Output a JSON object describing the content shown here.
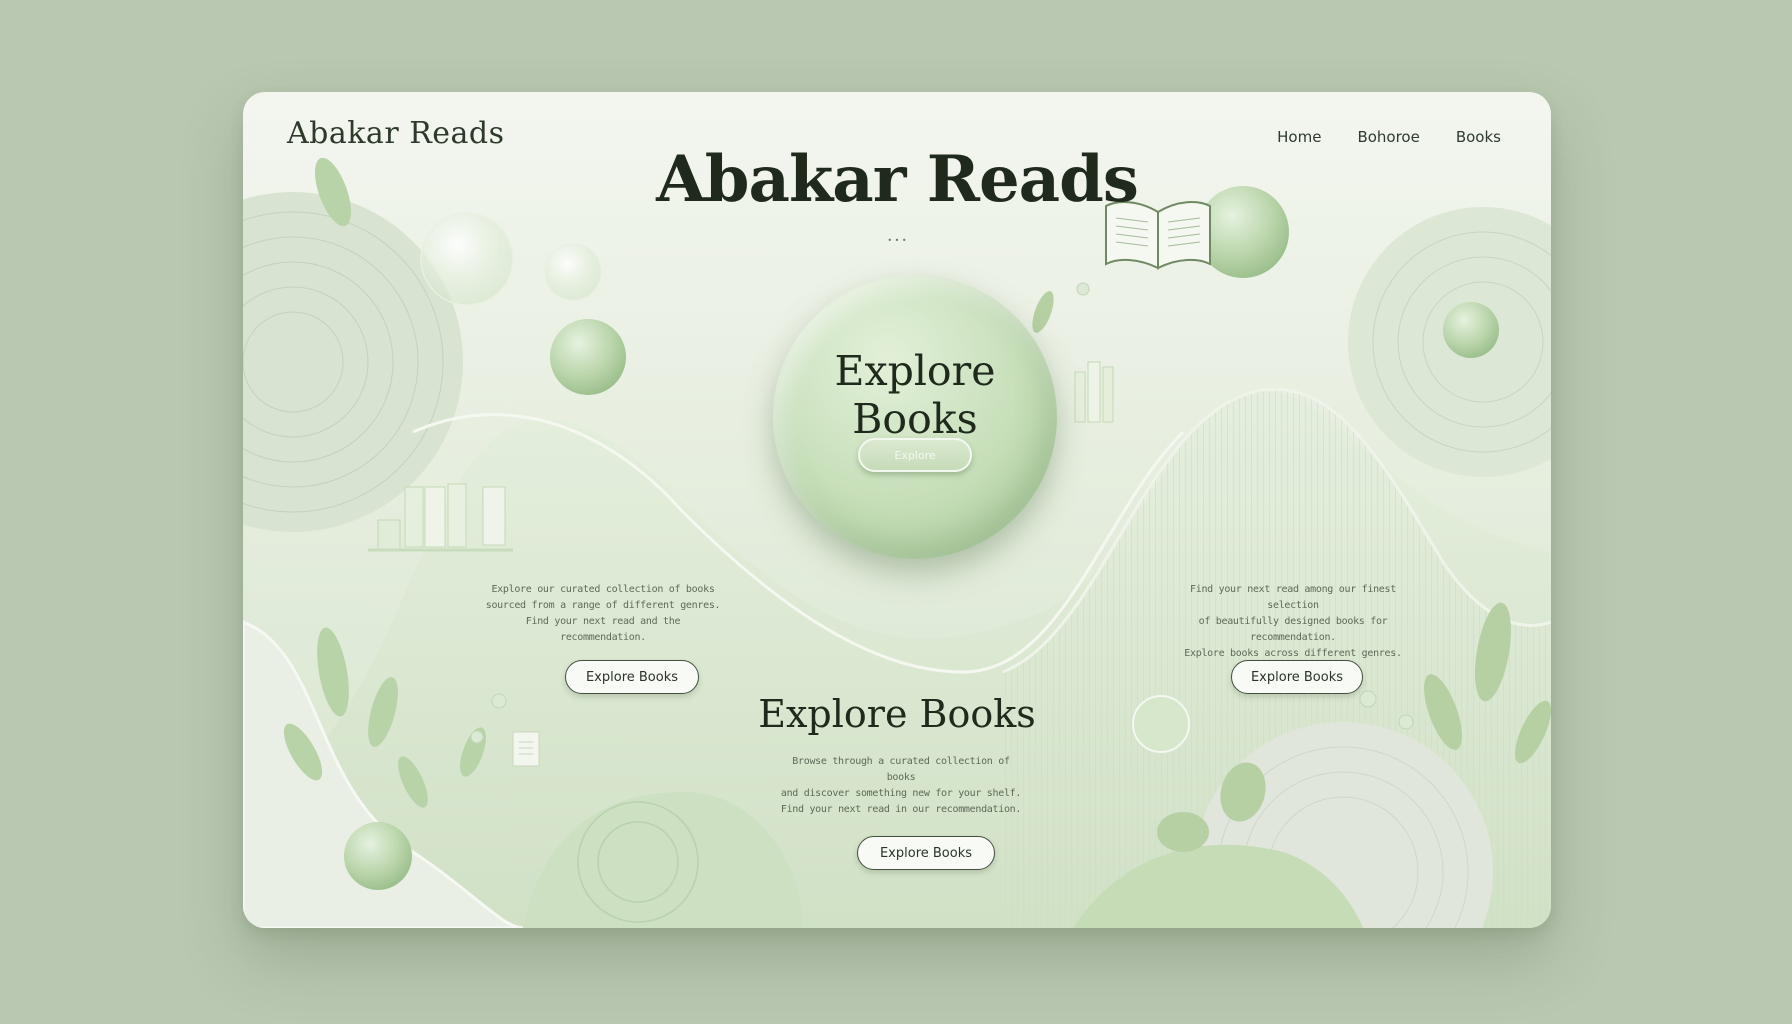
{
  "header": {
    "brand": "Abakar Reads",
    "nav": [
      "Home",
      "Bohoroe",
      "Books"
    ]
  },
  "hero": {
    "title": "Abakar Reads",
    "dots": "• • •"
  },
  "feature": {
    "title": "Explore Books",
    "button": "Explore"
  },
  "left_column": {
    "text": "Explore our curated collection of books\nsourced from a range of different genres.\nFind your next read and the recommendation.",
    "button": "Explore Books"
  },
  "right_column": {
    "text": "Find your next read among our finest selection\nof beautifully designed books for recommendation.\nExplore books across different genres.",
    "button": "Explore Books"
  },
  "section": {
    "title": "Explore Books",
    "text": "Browse through a curated collection of books\nand discover something new for your shelf.\nFind your next read in our recommendation.",
    "button": "Explore Books"
  },
  "colors": {
    "background": "#b9c8b1",
    "card": "#eaf1e4",
    "accent": "#b8d4a9",
    "text": "#1f2a1c"
  }
}
